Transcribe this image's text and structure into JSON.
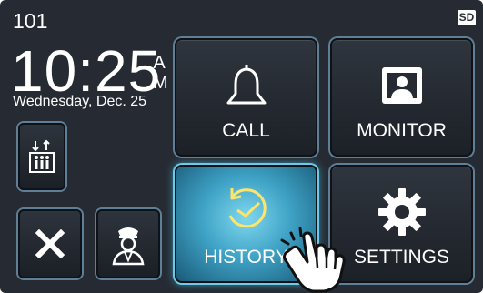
{
  "status": {
    "unit_number": "101",
    "sd_badge": "SD"
  },
  "clock": {
    "time": "10:25",
    "am": "A",
    "pm": "M",
    "date": "Wednesday, Dec. 25"
  },
  "buttons": {
    "call": {
      "label": "CALL",
      "icon": "bell-icon"
    },
    "monitor": {
      "label": "MONITOR",
      "icon": "portrait-icon"
    },
    "history": {
      "label": "HISTORY",
      "icon": "history-icon",
      "state": "pressed"
    },
    "settings": {
      "label": "SETTINGS",
      "icon": "gear-icon"
    },
    "elevator": {
      "icon": "elevator-icon"
    },
    "close": {
      "icon": "close-icon"
    },
    "guard": {
      "icon": "guard-icon"
    }
  },
  "colors": {
    "background": "#262b33",
    "accent_glow": "#3fb7dd",
    "text": "#ffffff"
  }
}
